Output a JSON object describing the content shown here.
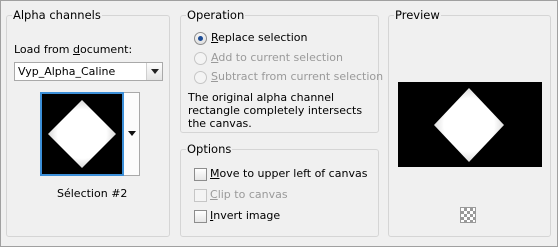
{
  "alpha_channels": {
    "title": "Alpha channels",
    "load_label_pre": "Load from ",
    "load_label_u": "d",
    "load_label_post": "ocument:",
    "document_value": "Vyp_Alpha_Caline",
    "selection_label": "Sélection #2"
  },
  "operation": {
    "title": "Operation",
    "options": [
      {
        "u": "R",
        "rest": "eplace selection",
        "checked": true,
        "enabled": true
      },
      {
        "u": "A",
        "rest": "dd to current selection",
        "checked": false,
        "enabled": false
      },
      {
        "u": "S",
        "rest": "ubtract from current selection",
        "checked": false,
        "enabled": false
      }
    ],
    "note": "The original alpha channel rectangle completely intersects the canvas."
  },
  "options": {
    "title": "Options",
    "items": [
      {
        "u": "M",
        "rest": "ove to upper left of canvas",
        "checked": false,
        "enabled": true
      },
      {
        "u": "C",
        "rest": "lip to canvas",
        "checked": false,
        "enabled": false
      },
      {
        "u": "I",
        "rest": "nvert image",
        "checked": false,
        "enabled": true
      }
    ]
  },
  "preview": {
    "title": "Preview",
    "zoom_icon": "checker-zoom-icon"
  }
}
